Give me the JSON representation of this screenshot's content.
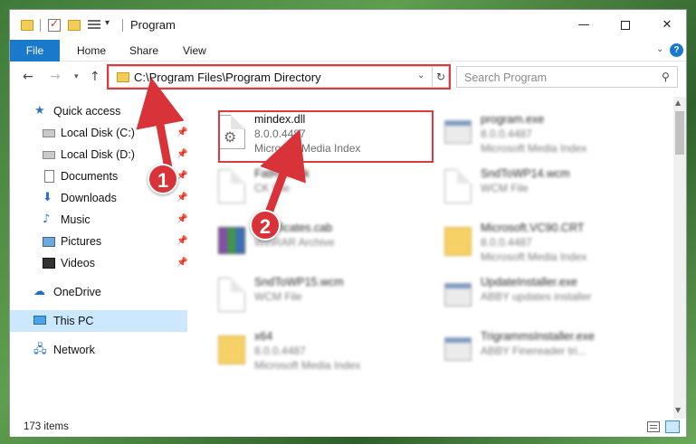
{
  "window": {
    "title": "Program",
    "minimize": "—",
    "maximize": "",
    "close": "✕"
  },
  "ribbon": {
    "tabs": [
      "File",
      "Home",
      "Share",
      "View"
    ],
    "help": "?"
  },
  "address": {
    "path": "C:\\Program Files\\Program Directory",
    "search_placeholder": "Search Program"
  },
  "nav_pane": {
    "items": [
      {
        "label": "Quick access",
        "icon": "star-icon",
        "pinned": false
      },
      {
        "label": "Local Disk (C:)",
        "icon": "drive-icon",
        "pinned": true
      },
      {
        "label": "Local Disk (D:)",
        "icon": "drive-icon",
        "pinned": true
      },
      {
        "label": "Documents",
        "icon": "documents-icon",
        "pinned": true
      },
      {
        "label": "Downloads",
        "icon": "download-icon",
        "pinned": true
      },
      {
        "label": "Music",
        "icon": "music-icon",
        "pinned": true
      },
      {
        "label": "Pictures",
        "icon": "pictures-icon",
        "pinned": true
      },
      {
        "label": "Videos",
        "icon": "videos-icon",
        "pinned": true
      },
      {
        "label": "OneDrive",
        "icon": "cloud-icon",
        "pinned": false
      },
      {
        "label": "This PC",
        "icon": "computer-icon",
        "pinned": false,
        "selected": true
      },
      {
        "label": "Network",
        "icon": "network-icon",
        "pinned": false
      }
    ]
  },
  "files": [
    {
      "name": "mindex.dll",
      "line2": "8.0.0.4487",
      "line3": "Microsoft Media Index",
      "icon": "dll-icon",
      "highlighted": true
    },
    {
      "name": "program.exe",
      "line2": "8.0.0.4487",
      "line3": "Microsoft Media Index",
      "icon": "exe-icon"
    },
    {
      "name": "FatRoot.rjk",
      "line2": "CK File",
      "line3": "",
      "icon": "file-icon"
    },
    {
      "name": "SndToWP14.wcm",
      "line2": "WCM File",
      "line3": "",
      "icon": "file-icon"
    },
    {
      "name": "Certificates.cab",
      "line2": "WinRAR Archive",
      "line3": "",
      "icon": "archive-icon"
    },
    {
      "name": "Microsoft.VC90.CRT",
      "line2": "8.0.0.4487",
      "line3": "Microsoft Media Index",
      "icon": "folder-icon"
    },
    {
      "name": "SndToWP15.wcm",
      "line2": "WCM File",
      "line3": "",
      "icon": "file-icon"
    },
    {
      "name": "UpdateInstaller.exe",
      "line2": "ABBY updates installer",
      "line3": "",
      "icon": "exe-icon"
    },
    {
      "name": "x64",
      "line2": "8.0.0.4487",
      "line3": "Microsoft Media Index",
      "icon": "folder-icon"
    },
    {
      "name": "TrigrammsInstaller.exe",
      "line2": "ABBY Finereader tri...",
      "line3": "",
      "icon": "exe-icon"
    }
  ],
  "status": {
    "item_count": "173 items"
  },
  "annotations": {
    "step1": "1",
    "step2": "2",
    "color": "#d9333a"
  }
}
